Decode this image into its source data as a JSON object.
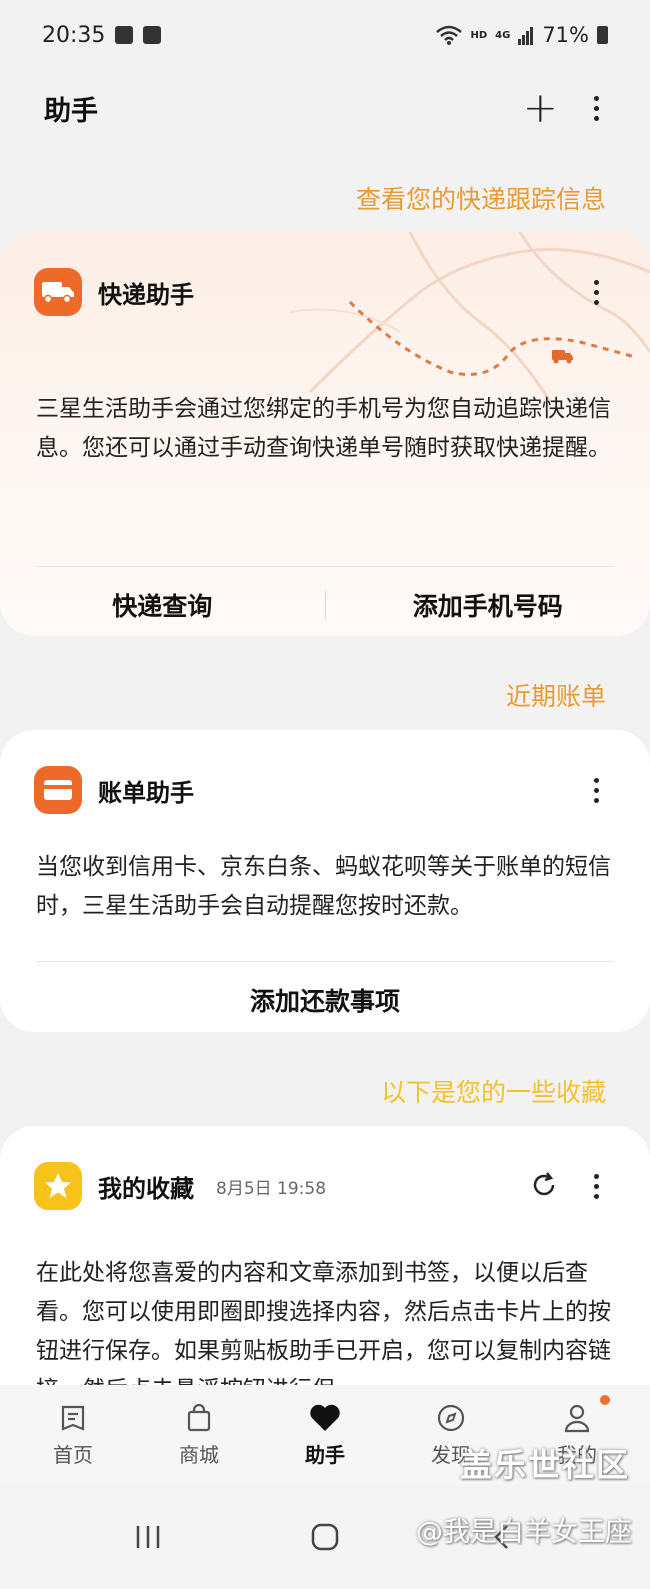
{
  "status_bar": {
    "time": "20:35",
    "network": "HD",
    "signal_type": "4G",
    "battery": "71%"
  },
  "header": {
    "title": "助手"
  },
  "express": {
    "section_link": "查看您的快递跟踪信息",
    "title": "快递助手",
    "description": "三星生活助手会通过您绑定的手机号为您自动追踪快递信息。您还可以通过手动查询快递单号随时获取快递提醒。",
    "button_query": "快递查询",
    "button_add_phone": "添加手机号码",
    "icon": "truck-icon",
    "accent": "#ee6a2a"
  },
  "bills": {
    "section_link": "近期账单",
    "title": "账单助手",
    "description": "当您收到信用卡、京东白条、蚂蚁花呗等关于账单的短信时，三星生活助手会自动提醒您按时还款。",
    "button_add": "添加还款事项",
    "icon": "card-icon",
    "accent": "#ee6a2a"
  },
  "favorites": {
    "section_link": "以下是您的一些收藏",
    "title": "我的收藏",
    "time": "8月5日 19:58",
    "description": "在此处将您喜爱的内容和文章添加到书签，以便以后查看。您可以使用即圈即搜选择内容，然后点击卡片上的按钮进行保存。如果剪贴板助手已开启，您可以复制内容链接，然后点击悬浮按钮进行保",
    "icon": "star-icon",
    "accent": "#f7c21a"
  },
  "bottom_nav": {
    "items": [
      {
        "label": "首页",
        "icon": "home-icon"
      },
      {
        "label": "商城",
        "icon": "shopping-bag-icon"
      },
      {
        "label": "助手",
        "icon": "heart-icon"
      },
      {
        "label": "发现",
        "icon": "compass-icon"
      },
      {
        "label": "我的",
        "icon": "person-icon"
      }
    ]
  },
  "watermark": {
    "line1": "盖乐世社区",
    "line2": "@我是白羊女王座"
  }
}
